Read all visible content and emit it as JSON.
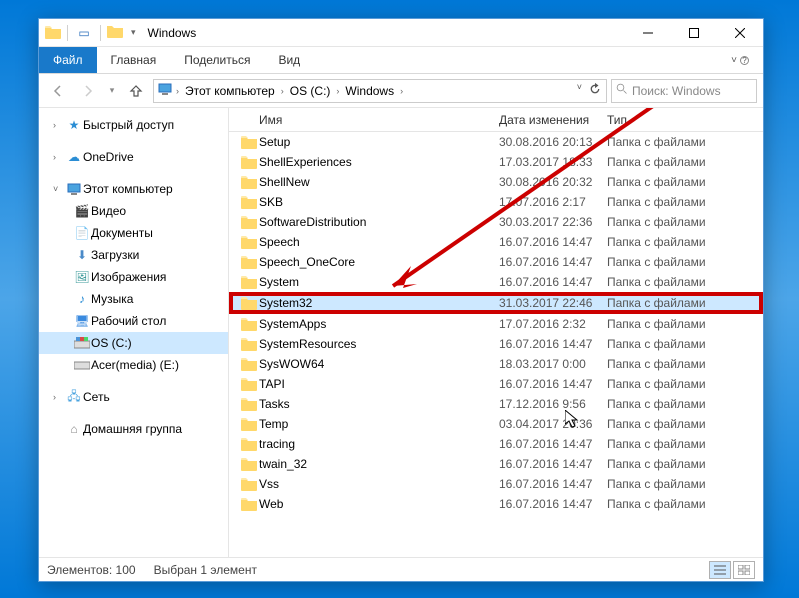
{
  "titlebar": {
    "title": "Windows"
  },
  "ribbon": {
    "file": "Файл",
    "tabs": [
      "Главная",
      "Поделиться",
      "Вид"
    ]
  },
  "breadcrumbs": [
    "Этот компьютер",
    "OS (C:)",
    "Windows"
  ],
  "search": {
    "placeholder": "Поиск: Windows"
  },
  "sidebar": {
    "quick": "Быстрый доступ",
    "onedrive": "OneDrive",
    "thispc": "Этот компьютер",
    "thispc_items": [
      "Видео",
      "Документы",
      "Загрузки",
      "Изображения",
      "Музыка",
      "Рабочий стол",
      "OS (C:)",
      "Acer(media) (E:)"
    ],
    "network": "Сеть",
    "homegroup": "Домашняя группа"
  },
  "columns": {
    "name": "Имя",
    "date": "Дата изменения",
    "type": "Тип"
  },
  "folder_type": "Папка с файлами",
  "files": [
    {
      "n": "Setup",
      "d": "30.08.2016 20:13"
    },
    {
      "n": "ShellExperiences",
      "d": "17.03.2017 18:33"
    },
    {
      "n": "ShellNew",
      "d": "30.08.2016 20:32"
    },
    {
      "n": "SKB",
      "d": "17.07.2016 2:17"
    },
    {
      "n": "SoftwareDistribution",
      "d": "30.03.2017 22:36"
    },
    {
      "n": "Speech",
      "d": "16.07.2016 14:47"
    },
    {
      "n": "Speech_OneCore",
      "d": "16.07.2016 14:47"
    },
    {
      "n": "System",
      "d": "16.07.2016 14:47"
    },
    {
      "n": "System32",
      "d": "31.03.2017 22:46",
      "sel": true
    },
    {
      "n": "SystemApps",
      "d": "17.07.2016 2:32"
    },
    {
      "n": "SystemResources",
      "d": "16.07.2016 14:47"
    },
    {
      "n": "SysWOW64",
      "d": "18.03.2017 0:00"
    },
    {
      "n": "TAPI",
      "d": "16.07.2016 14:47"
    },
    {
      "n": "Tasks",
      "d": "17.12.2016 9:56"
    },
    {
      "n": "Temp",
      "d": "03.04.2017 20:36"
    },
    {
      "n": "tracing",
      "d": "16.07.2016 14:47"
    },
    {
      "n": "twain_32",
      "d": "16.07.2016 14:47"
    },
    {
      "n": "Vss",
      "d": "16.07.2016 14:47"
    },
    {
      "n": "Web",
      "d": "16.07.2016 14:47"
    }
  ],
  "status": {
    "count": "Элементов: 100",
    "selected": "Выбран 1 элемент"
  }
}
